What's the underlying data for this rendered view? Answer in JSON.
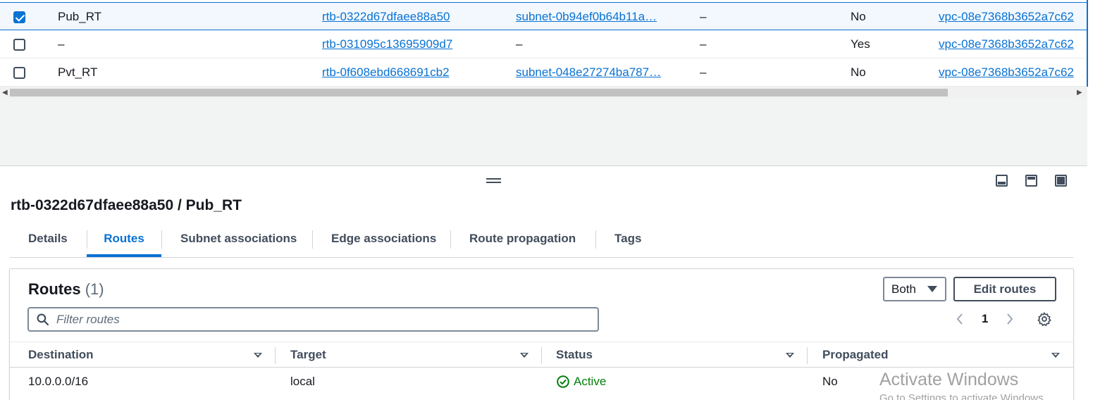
{
  "route_tables": [
    {
      "selected": true,
      "name": "Pub_RT",
      "id": "rtb-0322d67dfaee88a50",
      "subnet": "subnet-0b94ef0b64b11a…",
      "edge": "–",
      "main": "No",
      "vpc": "vpc-08e7368b3652a7c62"
    },
    {
      "selected": false,
      "name": "–",
      "id": "rtb-031095c13695909d7",
      "subnet": "–",
      "edge": "–",
      "main": "Yes",
      "vpc": "vpc-08e7368b3652a7c62"
    },
    {
      "selected": false,
      "name": "Pvt_RT",
      "id": "rtb-0f608ebd668691cb2",
      "subnet": "subnet-048e27274ba787…",
      "edge": "–",
      "main": "No",
      "vpc": "vpc-08e7368b3652a7c62"
    }
  ],
  "detail": {
    "title": "rtb-0322d67dfaee88a50 / Pub_RT",
    "tabs": [
      {
        "label": "Details",
        "active": false
      },
      {
        "label": "Routes",
        "active": true
      },
      {
        "label": "Subnet associations",
        "active": false
      },
      {
        "label": "Edge associations",
        "active": false
      },
      {
        "label": "Route propagation",
        "active": false
      },
      {
        "label": "Tags",
        "active": false
      }
    ]
  },
  "routes": {
    "heading": "Routes",
    "count": "(1)",
    "filter_placeholder": "Filter routes",
    "filter_value": "",
    "select_value": "Both",
    "edit_button": "Edit routes",
    "page": "1",
    "columns": [
      "Destination",
      "Target",
      "Status",
      "Propagated"
    ],
    "rows": [
      {
        "destination": "10.0.0.0/16",
        "target": "local",
        "status": "Active",
        "propagated": "No"
      }
    ]
  },
  "watermark": {
    "title": "Activate Windows",
    "subtitle": "Go to Settings to activate Windows."
  },
  "colors": {
    "link": "#0972d3",
    "success": "#037f0c",
    "text": "#16191f"
  },
  "icons": [
    "checkbox-icon",
    "drag-handle-icon",
    "panel-bottom-icon",
    "panel-side-icon",
    "panel-full-icon",
    "search-icon",
    "caret-down-icon",
    "chevron-left-icon",
    "chevron-right-icon",
    "gear-icon",
    "sort-icon",
    "status-ok-icon"
  ]
}
